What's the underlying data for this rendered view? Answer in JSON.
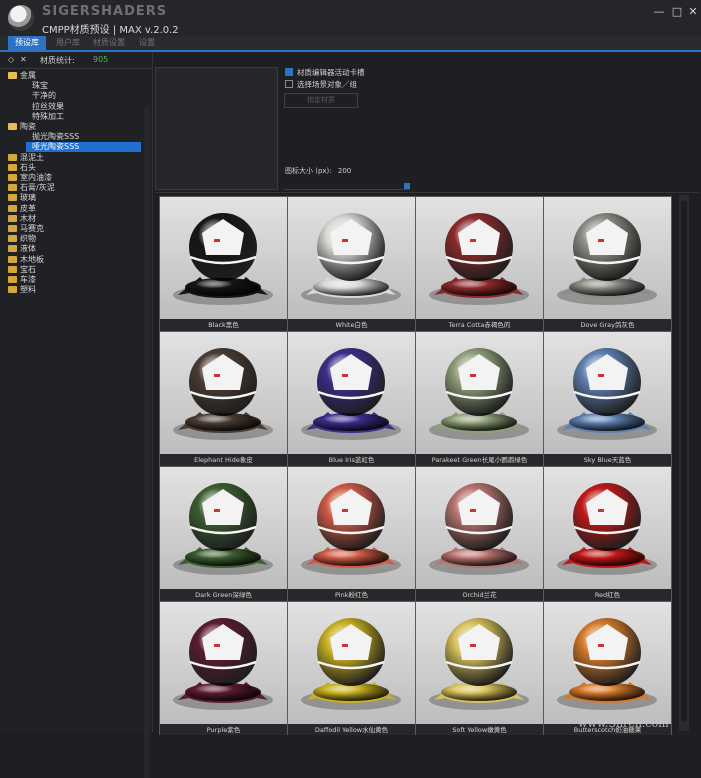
{
  "app": {
    "brand": "SIGERSHADERS",
    "subtitle": "CMPP材质预设 | MAX v.2.0.2",
    "minimize": "—",
    "maximize": "□",
    "close": "✕"
  },
  "tabs": [
    "预设库",
    "用户库",
    "材质设置",
    "设置"
  ],
  "left_panel": {
    "header_icons": [
      "◇",
      "✕"
    ],
    "count_label": "材质统计:",
    "count_value": "905",
    "tree": [
      {
        "label": "金属",
        "level": 0,
        "open": true
      },
      {
        "label": "珠宝",
        "level": 1
      },
      {
        "label": "干净的",
        "level": 1
      },
      {
        "label": "拉丝效果",
        "level": 1
      },
      {
        "label": "特殊加工",
        "level": 1
      },
      {
        "label": "陶瓷",
        "level": 0,
        "open": true
      },
      {
        "label": "抛光陶瓷SSS",
        "level": 1
      },
      {
        "label": "哑光陶瓷SSS",
        "level": 1,
        "selected": true
      },
      {
        "label": "混泥土",
        "level": 0
      },
      {
        "label": "石头",
        "level": 0
      },
      {
        "label": "室内油漆",
        "level": 0
      },
      {
        "label": "石膏/灰泥",
        "level": 0
      },
      {
        "label": "玻璃",
        "level": 0
      },
      {
        "label": "皮革",
        "level": 0
      },
      {
        "label": "木材",
        "level": 0
      },
      {
        "label": "马赛克",
        "level": 0
      },
      {
        "label": "织物",
        "level": 0
      },
      {
        "label": "液体",
        "level": 0
      },
      {
        "label": "木地板",
        "level": 0
      },
      {
        "label": "宝石",
        "level": 0
      },
      {
        "label": "车漆",
        "level": 0
      },
      {
        "label": "塑料",
        "level": 0
      }
    ]
  },
  "options": {
    "opt1": "材质编辑器活动卡槽",
    "opt2": "选择场景对象／组",
    "apply_button": "指定材质",
    "icon_size_label": "图标大小 (px):",
    "icon_size_value": "200"
  },
  "materials": [
    {
      "label": "Black黑色",
      "color": "#151515"
    },
    {
      "label": "White白色",
      "color": "#d9d9d6"
    },
    {
      "label": "Terra Cotta赤褐色的",
      "color": "#8c2a2b"
    },
    {
      "label": "Dove Gray鸽灰色",
      "color": "#8c8d86"
    },
    {
      "label": "Elephant Hide象皮",
      "color": "#4a3c33"
    },
    {
      "label": "Blue Iris蓝虹色",
      "color": "#3b2d8a"
    },
    {
      "label": "Parakeet Green长尾小鹦鹉绿色",
      "color": "#8f9f79"
    },
    {
      "label": "Sky Blue天蓝色",
      "color": "#5e7fb0"
    },
    {
      "label": "Dark Green深绿色",
      "color": "#3c5f30"
    },
    {
      "label": "Pink粉红色",
      "color": "#d05a45"
    },
    {
      "label": "Orchid兰花",
      "color": "#b7746f"
    },
    {
      "label": "Red红色",
      "color": "#c01818"
    },
    {
      "label": "Purple紫色",
      "color": "#5a1b33"
    },
    {
      "label": "Daffodil Yellow水仙黄色",
      "color": "#c9b020"
    },
    {
      "label": "Soft Yellow嫩黄色",
      "color": "#d6c15a"
    },
    {
      "label": "Butterscotch奶油糖果",
      "color": "#d67a2a"
    }
  ],
  "watermark": "www.Snren.com"
}
